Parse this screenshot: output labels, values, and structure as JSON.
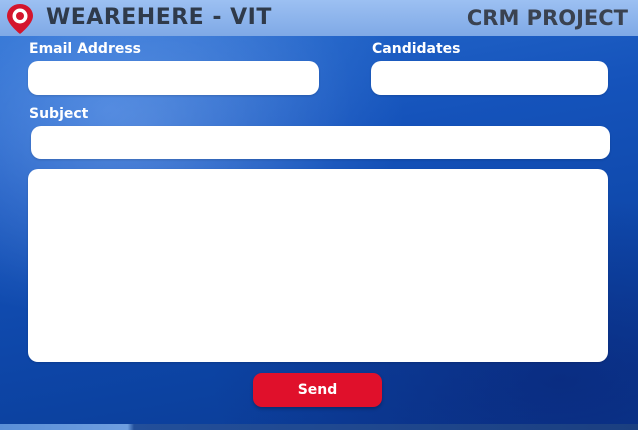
{
  "header": {
    "brand": "WEAREHERE - VIT",
    "project": "CRM PROJECT",
    "logo_icon": "map-pin-icon"
  },
  "form": {
    "email_label": "Email Address",
    "email_value": "",
    "candidates_label": "Candidates",
    "candidates_value": "",
    "subject_label": "Subject",
    "subject_value": "",
    "message_value": "",
    "send_label": "Send"
  },
  "colors": {
    "accent_red": "#e0102b",
    "background_blue": "#1553bb",
    "header_blue": "#9cc0f2"
  }
}
